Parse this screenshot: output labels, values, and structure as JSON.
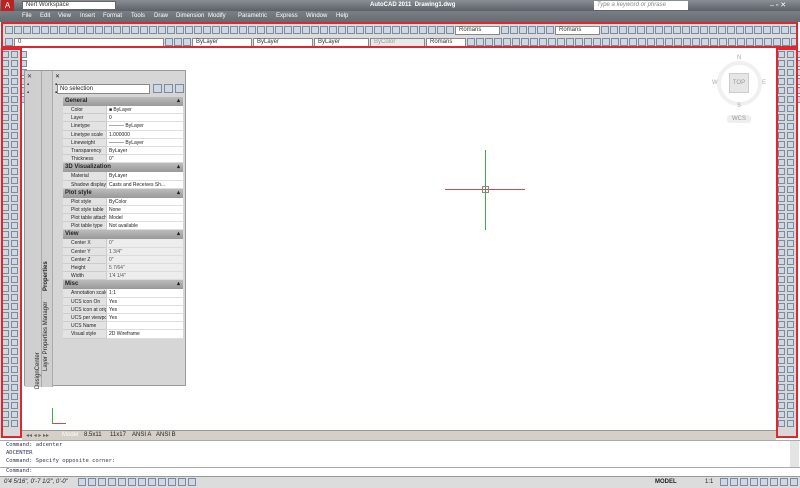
{
  "title": {
    "app": "AutoCAD 2011",
    "file": "Drawing1.dwg",
    "workspace": "Nert Workspace",
    "search_placeholder": "Type a keyword or phrase"
  },
  "menu": [
    "File",
    "Edit",
    "View",
    "Insert",
    "Format",
    "Tools",
    "Draw",
    "Dimension",
    "Modify",
    "Parametric",
    "Express",
    "Window",
    "Help"
  ],
  "toolbar": {
    "layer": "0",
    "color": "ByLayer",
    "linetype": "ByLayer",
    "lineweight": "ByLayer",
    "plotstyle": "ByColor",
    "textstyle1": "Romans",
    "dimstyle": "Romans",
    "textstyle2": "Romans",
    "textstyle3": "Romans"
  },
  "palette": {
    "selection": "No selection",
    "tabs": [
      "Properties",
      "Layer Properties Manager",
      "DesignCenter"
    ],
    "sections": [
      {
        "title": "General",
        "rows": [
          [
            "Color",
            "■ ByLayer"
          ],
          [
            "Layer",
            "0"
          ],
          [
            "Linetype",
            "——— ByLayer"
          ],
          [
            "Linetype scale",
            "1.000000"
          ],
          [
            "Lineweight",
            "——— ByLayer"
          ],
          [
            "Transparency",
            "ByLayer"
          ],
          [
            "Thickness",
            "0\""
          ]
        ]
      },
      {
        "title": "3D Visualization",
        "rows": [
          [
            "Material",
            "ByLayer"
          ],
          [
            "Shadow display",
            "Casts and Receives Sh..."
          ]
        ]
      },
      {
        "title": "Plot style",
        "rows": [
          [
            "Plot style",
            "ByColor"
          ],
          [
            "Plot style table",
            "None"
          ],
          [
            "Plot table attache...",
            "Model"
          ],
          [
            "Plot table type",
            "Not available"
          ]
        ]
      },
      {
        "title": "View",
        "rows": [
          [
            "Center X",
            "0\""
          ],
          [
            "Center Y",
            "1 3/4\""
          ],
          [
            "Center Z",
            "0\""
          ],
          [
            "Height",
            "5 7/64\""
          ],
          [
            "Width",
            "1'4 1/4\""
          ]
        ]
      },
      {
        "title": "Misc",
        "rows": [
          [
            "Annotation scale",
            "1:1"
          ],
          [
            "UCS icon On",
            "Yes"
          ],
          [
            "UCS icon at origin",
            "Yes"
          ],
          [
            "UCS per viewport",
            "Yes"
          ],
          [
            "UCS Name",
            ""
          ],
          [
            "Visual style",
            "2D Wireframe"
          ]
        ]
      }
    ]
  },
  "viewcube": {
    "n": "N",
    "s": "S",
    "e": "E",
    "w": "W",
    "face": "TOP",
    "wcs": "WCS"
  },
  "layout_tabs": [
    "Model",
    "8.5x11",
    "11x17",
    "ANSI A",
    "ANSI B"
  ],
  "command_lines": [
    "Command: adcenter",
    "ADCENTER",
    "Command: Specify opposite corner:",
    "Command:"
  ],
  "status": {
    "coords": "0'4 5/16\", 0'-7 1/2\", 0'-0\"",
    "model": "MODEL",
    "scale": "1:1"
  },
  "colors": {
    "highlight": "#e2262f"
  }
}
